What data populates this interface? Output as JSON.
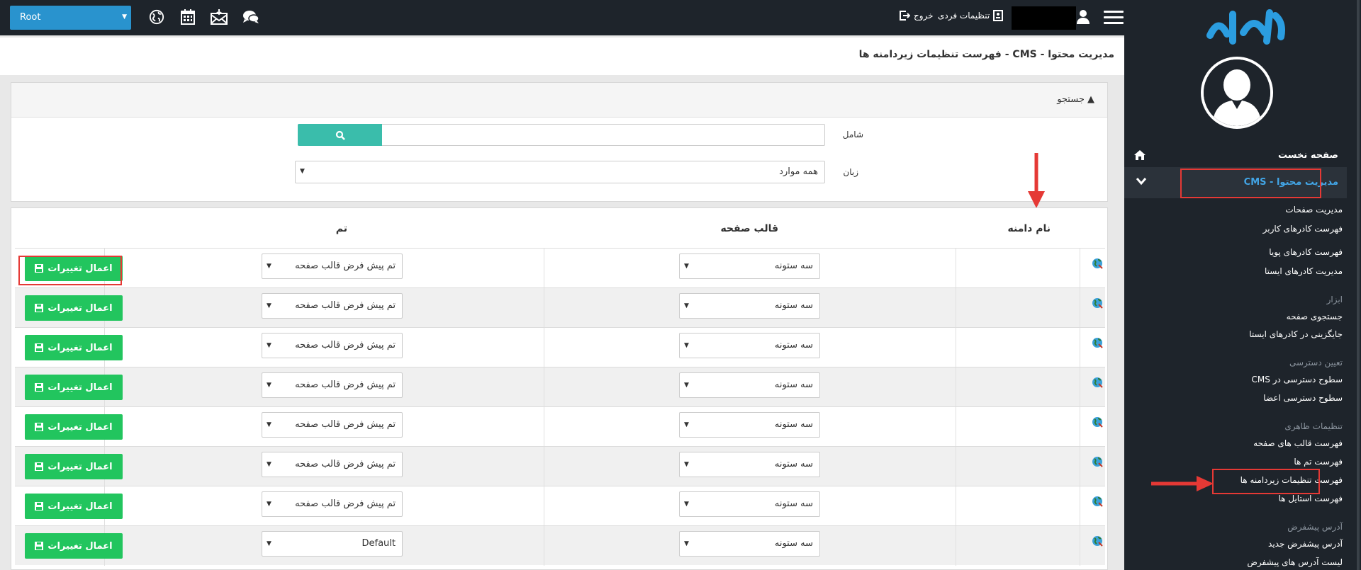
{
  "topbar": {
    "root_select": "Root",
    "logout_label": "خروج",
    "personal_settings_label": "تنظیمات فردی",
    "icons": [
      "globe-icon",
      "calendar-icon",
      "mail-icon",
      "chat-icon"
    ]
  },
  "sidebar": {
    "home": "صفحه نخست",
    "cms": "مدیریت محتوا - CMS",
    "items": [
      {
        "label": "مدیریت صفحات",
        "type": "link"
      },
      {
        "label": "فهرست کادرهای کاربر",
        "type": "link"
      },
      {
        "label": "فهرست کادرهای پویا",
        "type": "link"
      },
      {
        "label": "مدیریت کادرهای ایستا",
        "type": "link"
      },
      {
        "label": "ابزار",
        "type": "head"
      },
      {
        "label": "جستجوی صفحه",
        "type": "link"
      },
      {
        "label": "جایگزینی در کادرهای ایستا",
        "type": "link"
      },
      {
        "label": "تعیین دسترسی",
        "type": "head"
      },
      {
        "label": "سطوح دسترسی در CMS",
        "type": "link"
      },
      {
        "label": "سطوح دسترسی اعضا",
        "type": "link"
      },
      {
        "label": "تنظیمات ظاهری",
        "type": "head"
      },
      {
        "label": "فهرست قالب های صفحه",
        "type": "link"
      },
      {
        "label": "فهرست تم ها",
        "type": "link"
      },
      {
        "label": "فهرست تنظیمات زیردامنه ها",
        "type": "link"
      },
      {
        "label": "فهرست استایل ها",
        "type": "link"
      },
      {
        "label": "آدرس پیشفرض",
        "type": "head"
      },
      {
        "label": "آدرس پیشفرض جدید",
        "type": "link"
      },
      {
        "label": "لیست آدرس های پیشفرض",
        "type": "link"
      }
    ]
  },
  "breadcrumb": "مدیریت محتوا - CMS - فهرست تنظیمات زیردامنه ها",
  "search": {
    "title": "جستجو",
    "contains_label": "شامل",
    "contains_value": "",
    "language_label": "زبان",
    "language_value": "همه موارد"
  },
  "table": {
    "headers": {
      "domain": "نام دامنه",
      "template": "قالب صفحه",
      "theme": "تم"
    },
    "apply_label": "اعمال تغییرات",
    "rows": [
      {
        "template": "سه ستونه",
        "theme": "تم پیش فرض قالب صفحه"
      },
      {
        "template": "سه ستونه",
        "theme": "تم پیش فرض قالب صفحه"
      },
      {
        "template": "سه ستونه",
        "theme": "تم پیش فرض قالب صفحه"
      },
      {
        "template": "سه ستونه",
        "theme": "تم پیش فرض قالب صفحه"
      },
      {
        "template": "سه ستونه",
        "theme": "تم پیش فرض قالب صفحه"
      },
      {
        "template": "سه ستونه",
        "theme": "تم پیش فرض قالب صفحه"
      },
      {
        "template": "سه ستونه",
        "theme": "تم پیش فرض قالب صفحه"
      },
      {
        "template": "سه ستونه",
        "theme": "Default"
      }
    ]
  },
  "colors": {
    "accent": "#2993ce",
    "search_button": "#3abdab",
    "apply_button": "#22c55e",
    "highlight": "#e53935"
  }
}
